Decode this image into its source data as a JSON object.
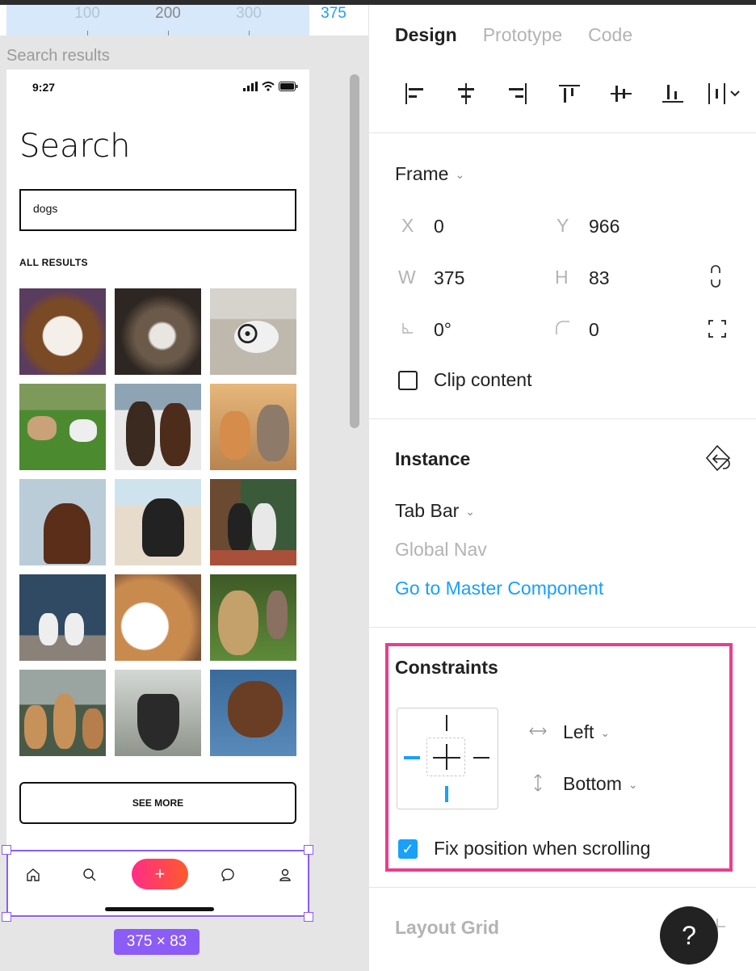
{
  "ruler": {
    "ticks": [
      "100",
      "200",
      "300",
      "375"
    ]
  },
  "canvas": {
    "frame_label": "Search results"
  },
  "phone": {
    "time": "9:27",
    "title": "Search",
    "search_value": "dogs",
    "section_label": "ALL RESULTS",
    "see_more": "SEE MORE",
    "photos": [
      "dog-photo-1",
      "dog-photo-2",
      "dog-photo-3",
      "dog-photo-4",
      "dog-photo-5",
      "dog-photo-6",
      "dog-photo-7",
      "dog-photo-8",
      "dog-photo-9",
      "dog-photo-10",
      "dog-photo-11",
      "dog-photo-12",
      "dog-photo-13",
      "dog-photo-14",
      "dog-photo-15"
    ],
    "tabbar_icons": [
      "home-icon",
      "search-icon",
      "plus-icon",
      "chat-icon",
      "profile-icon"
    ],
    "fab_label": "+",
    "size_badge": "375 × 83"
  },
  "panel": {
    "tabs": [
      "Design",
      "Prototype",
      "Code"
    ],
    "align_icons": [
      "align-left-icon",
      "align-horizontal-center-icon",
      "align-right-icon",
      "align-top-icon",
      "align-vertical-center-icon",
      "align-bottom-icon",
      "distribute-icon"
    ],
    "frame": {
      "title": "Frame",
      "x_label": "X",
      "x": "0",
      "y_label": "Y",
      "y": "966",
      "w_label": "W",
      "w": "375",
      "h_label": "H",
      "h": "83",
      "rotation": "0°",
      "radius": "0",
      "clip_label": "Clip content"
    },
    "instance": {
      "title": "Instance",
      "component": "Tab Bar",
      "component_sub": "Global Nav",
      "master_link": "Go to Master Component"
    },
    "constraints": {
      "title": "Constraints",
      "horizontal": "Left",
      "vertical": "Bottom",
      "fix_label": "Fix position when scrolling",
      "fix_checked": true
    },
    "layout_grid": {
      "title": "Layout Grid"
    },
    "help": "?"
  },
  "colors": {
    "accent": "#18a0fb",
    "selection": "#8b5cf6",
    "highlight": "#e83e8c"
  }
}
